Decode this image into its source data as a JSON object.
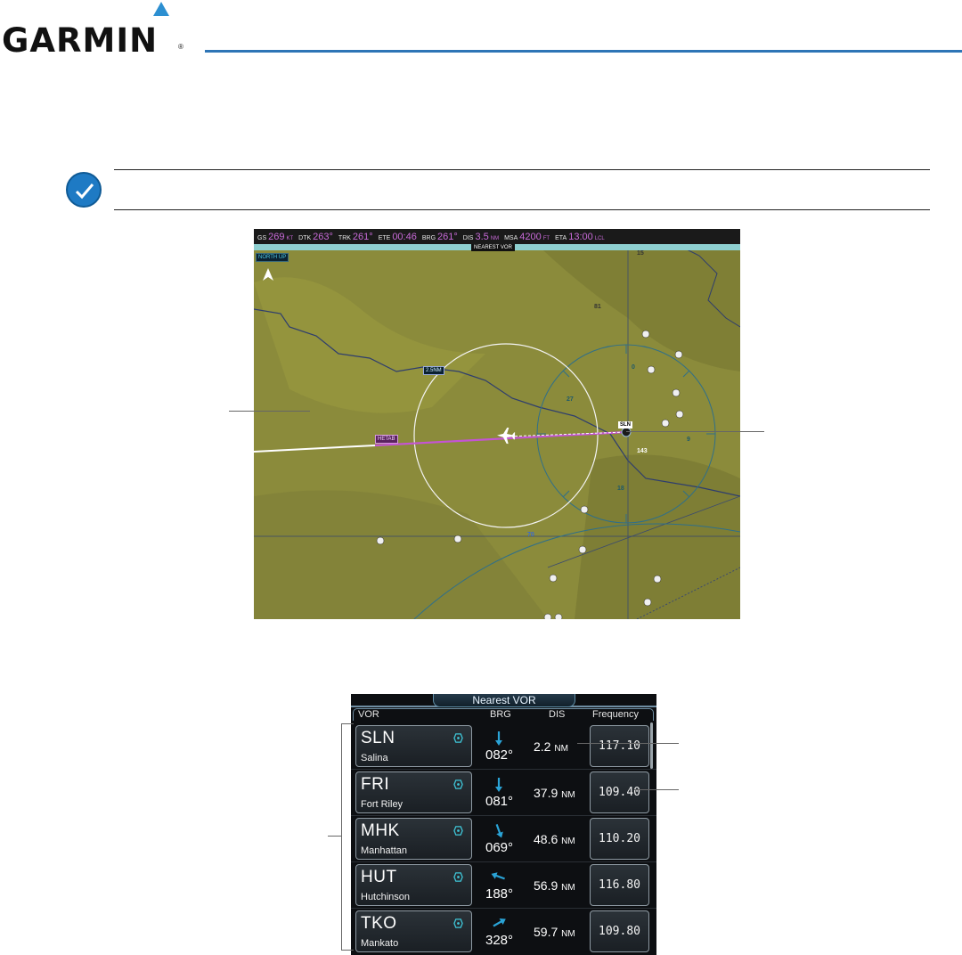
{
  "header": {
    "brand": "GARMIN",
    "registered_mark": "®",
    "accent_color": "#2e75b6"
  },
  "note_icon": "pencil-check-icon",
  "map": {
    "datafields": [
      {
        "label": "GS",
        "value": "269",
        "unit": "KT"
      },
      {
        "label": "DTK",
        "value": "263°",
        "unit": ""
      },
      {
        "label": "TRK",
        "value": "261°",
        "unit": ""
      },
      {
        "label": "ETE",
        "value": "00:46",
        "unit": ""
      },
      {
        "label": "BRG",
        "value": "261°",
        "unit": ""
      },
      {
        "label": "DIS",
        "value": "3.5",
        "unit": "NM"
      },
      {
        "label": "MSA",
        "value": "4200",
        "unit": "FT"
      },
      {
        "label": "ETA",
        "value": "13:00",
        "unit": "LCL"
      }
    ],
    "title": "NEAREST VOR",
    "orientation": "NORTH UP",
    "range_label": "2.5NM",
    "waypoint": "HETAB",
    "vor_label": "SLN",
    "compass_labels": [
      "27",
      "9",
      "18",
      "0"
    ],
    "airway_numbers": [
      "81",
      "143",
      "70",
      "15"
    ]
  },
  "panel": {
    "title": "Nearest VOR",
    "columns": {
      "vor": "VOR",
      "brg": "BRG",
      "dis": "DIS",
      "frequency": "Frequency"
    },
    "rows": [
      {
        "ident": "SLN",
        "city": "Salina",
        "brg": "082°",
        "dis": "2.2",
        "unit": "NM",
        "freq": "117.10",
        "arrow_deg": 180
      },
      {
        "ident": "FRI",
        "city": "Fort Riley",
        "brg": "081°",
        "dis": "37.9",
        "unit": "NM",
        "freq": "109.40",
        "arrow_deg": 180
      },
      {
        "ident": "MHK",
        "city": "Manhattan",
        "brg": "069°",
        "dis": "48.6",
        "unit": "NM",
        "freq": "110.20",
        "arrow_deg": 160
      },
      {
        "ident": "HUT",
        "city": "Hutchinson",
        "brg": "188°",
        "dis": "56.9",
        "unit": "NM",
        "freq": "116.80",
        "arrow_deg": 290
      },
      {
        "ident": "TKO",
        "city": "Mankato",
        "brg": "328°",
        "dis": "59.7",
        "unit": "NM",
        "freq": "109.80",
        "arrow_deg": 60
      }
    ]
  }
}
